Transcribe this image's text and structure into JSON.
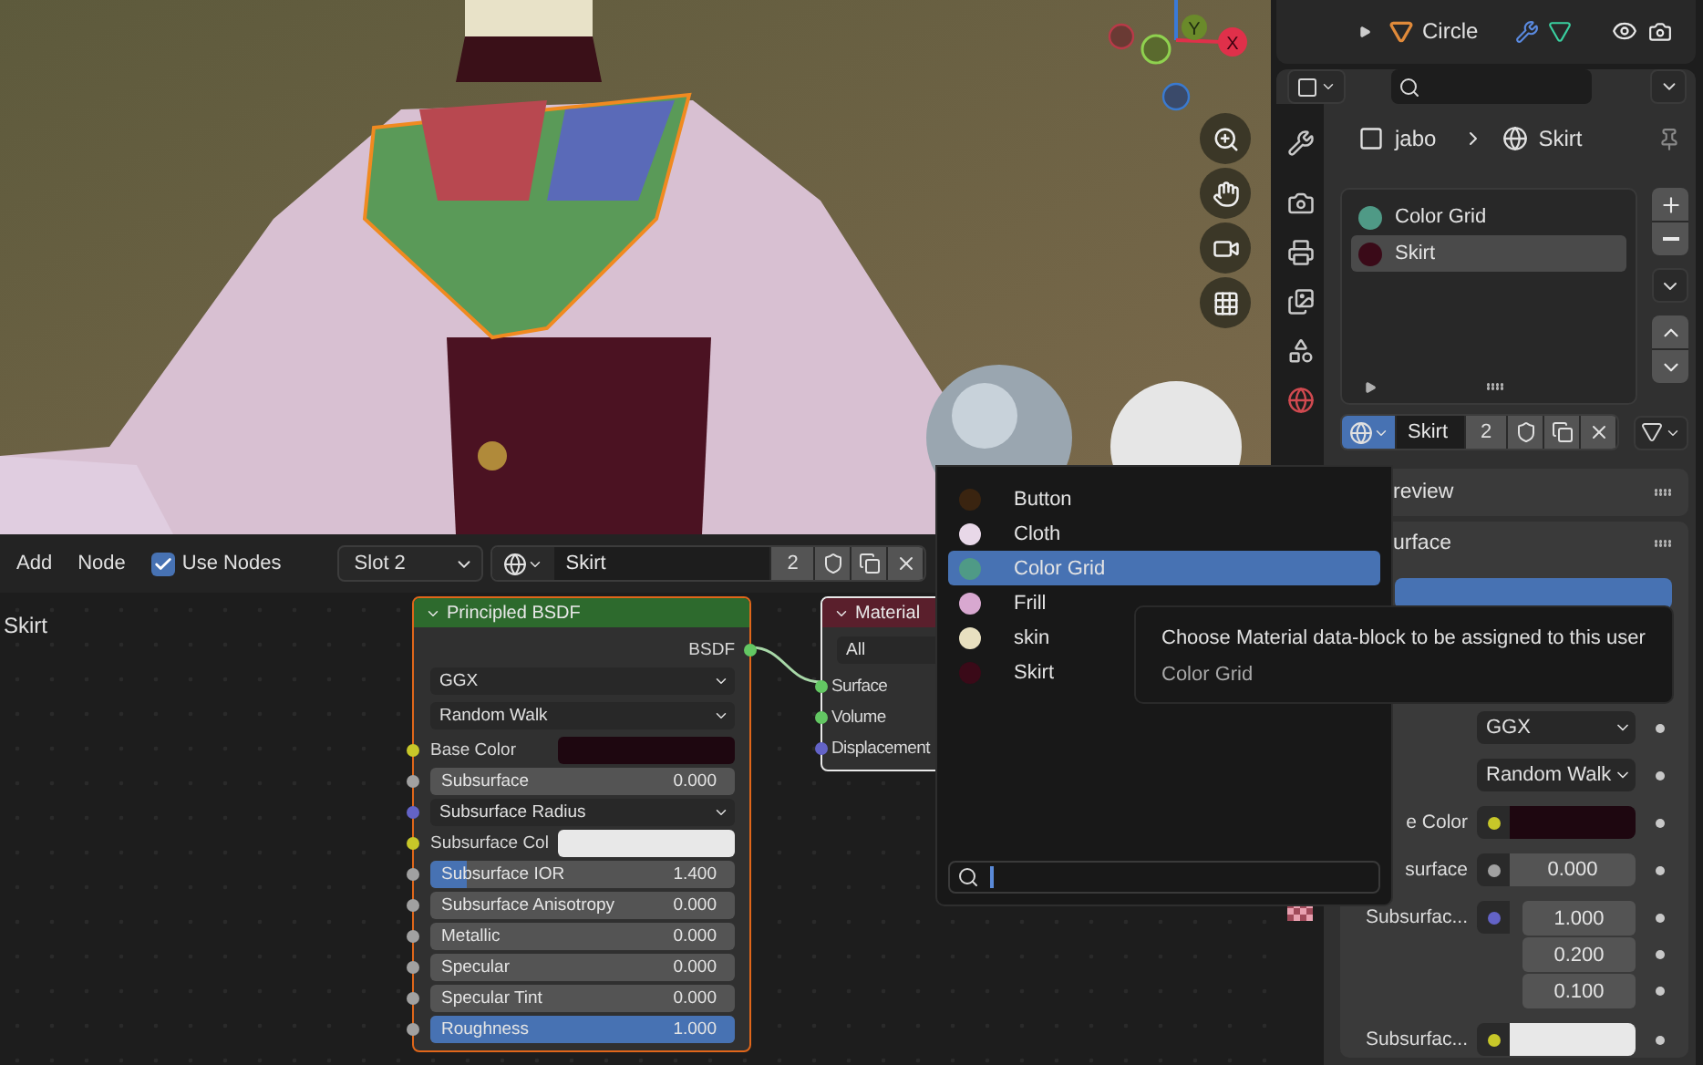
{
  "viewport": {
    "gizmo": {
      "x": "X",
      "y": "Y"
    }
  },
  "outliner": {
    "rows": [
      {
        "name": "Circle",
        "expanded": false
      }
    ]
  },
  "properties": {
    "breadcrumb": [
      "jabo",
      "Skirt"
    ],
    "slots": [
      {
        "name": "Color Grid",
        "color": "#4f9a86",
        "selected": false
      },
      {
        "name": "Skirt",
        "color": "#3a0a18",
        "selected": true
      }
    ],
    "datablock": {
      "name": "Skirt",
      "users": "2"
    },
    "panels": [
      "review",
      "urface"
    ],
    "rows": [
      {
        "kind": "dropdown",
        "value": "GGX"
      },
      {
        "kind": "dropdown",
        "value": "Random Walk"
      },
      {
        "kind": "color",
        "label": "e Color",
        "color": "#c7c729",
        "swatch": {
          "color": "#1e0710"
        }
      },
      {
        "kind": "number",
        "label": "surface",
        "color": "#a1a1a1",
        "value": "0.000"
      },
      {
        "kind": "vector",
        "label": "Subsurfac...",
        "color": "#6363c7",
        "values": [
          "1.000",
          "0.200",
          "0.100"
        ]
      },
      {
        "kind": "color",
        "label": "Subsurfac...",
        "color": "#c7c729",
        "swatch": {
          "color": "#e8e8e8"
        }
      }
    ]
  },
  "node_editor": {
    "menus": [
      "Add",
      "Node"
    ],
    "use_nodes": {
      "label": "Use Nodes",
      "checked": true
    },
    "slot": "Slot 2",
    "material": {
      "name": "Skirt",
      "users": "2"
    },
    "breadcrumb": "Skirt",
    "nodes": [
      {
        "kind": "principled",
        "title": "Principled BSDF",
        "rows": [
          {
            "kind": "output",
            "label": "BSDF",
            "color": "#63c763"
          },
          {
            "kind": "dropdown",
            "value": "GGX"
          },
          {
            "kind": "dropdown",
            "value": "Random Walk"
          },
          {
            "kind": "color",
            "label": "Base Color",
            "color": "#c7c729",
            "swatch": {
              "color": "#1e0710"
            }
          },
          {
            "kind": "number",
            "label": "Subsurface",
            "value": "0.000",
            "color": "#a1a1a1"
          },
          {
            "kind": "dropdown",
            "value": "Subsurface Radius",
            "color": "#6363c7"
          },
          {
            "kind": "color",
            "label": "Subsurface Col",
            "color": "#c7c729",
            "swatch": {
              "color": "#e8e8e8"
            }
          },
          {
            "kind": "slider",
            "label": "Subsurface IOR",
            "value": "1.400",
            "level": 0.12,
            "color": "#a1a1a1"
          },
          {
            "kind": "number",
            "label": "Subsurface Anisotropy",
            "value": "0.000",
            "color": "#a1a1a1"
          },
          {
            "kind": "number",
            "label": "Metallic",
            "value": "0.000",
            "color": "#a1a1a1"
          },
          {
            "kind": "number",
            "label": "Specular",
            "value": "0.000",
            "color": "#a1a1a1"
          },
          {
            "kind": "number",
            "label": "Specular Tint",
            "value": "0.000",
            "color": "#a1a1a1"
          },
          {
            "kind": "slider",
            "label": "Roughness",
            "value": "1.000",
            "level": 1,
            "color": "#a1a1a1"
          }
        ]
      },
      {
        "kind": "output",
        "title": "Material",
        "target": "All",
        "inputs": [
          {
            "label": "Surface",
            "color": "#63c763"
          },
          {
            "label": "Volume",
            "color": "#63c763"
          },
          {
            "label": "Displacement",
            "color": "#6363c7"
          }
        ]
      }
    ]
  },
  "material_popup": {
    "items": [
      {
        "name": "Button",
        "color": "#3a2410",
        "selected": false
      },
      {
        "name": "Cloth",
        "color": "#e8d8e8",
        "selected": false
      },
      {
        "name": "Color Grid",
        "color": "#4f9a86",
        "selected": true
      },
      {
        "name": "Frill",
        "color": "#d8a8d0",
        "selected": false
      },
      {
        "name": "skin",
        "color": "#e8e0c0",
        "selected": false
      },
      {
        "name": "Skirt",
        "color": "#3a0a18",
        "selected": false
      }
    ]
  },
  "tooltip": {
    "text": "Choose Material data-block to be assigned to this user",
    "value": "Color Grid"
  }
}
